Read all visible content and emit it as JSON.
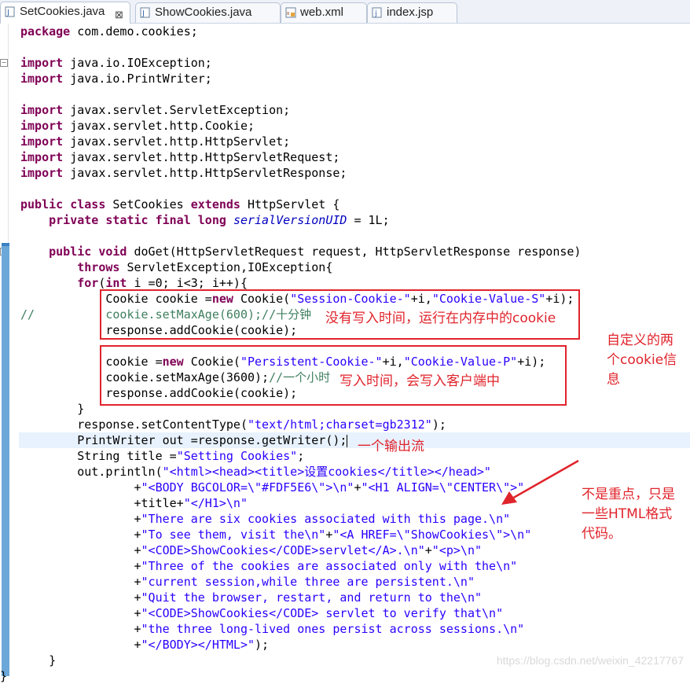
{
  "tabs": [
    {
      "label": "SetCookies.java",
      "icon": "java-file-icon",
      "active": true,
      "close": "⊠"
    },
    {
      "label": "ShowCookies.java",
      "icon": "java-file-icon"
    },
    {
      "label": "web.xml",
      "icon": "xml-file-icon"
    },
    {
      "label": "index.jsp",
      "icon": "jsp-file-icon"
    }
  ],
  "code": {
    "package": "com.demo.cookies;",
    "imports": [
      "java.io.IOException;",
      "java.io.PrintWriter;",
      "javax.servlet.ServletException;",
      "javax.servlet.http.Cookie;",
      "javax.servlet.http.HttpServlet;",
      "javax.servlet.http.HttpServletRequest;",
      "javax.servlet.http.HttpServletResponse;"
    ],
    "class_name": " SetCookies ",
    "super_name": " HttpServlet {",
    "field_name": "serialVersionUID",
    "field_value": " = 1L;",
    "method_sig": " doGet(HttpServletRequest request, HttpServletResponse response)",
    "throws_list": " ServletException,IOException{",
    "for_head": "(",
    "for_rest": " i =0; i<3; i++){",
    "c1_prefix": "Cookie cookie =",
    "c1_mid": " Cookie(",
    "c1_name": "\"Session-Cookie-\"",
    "c1_plus": "+i,",
    "c1_value": "\"Cookie-Value-S\"",
    "c1_end": "+i);",
    "commented_line": "//          cookie.setMaxAge(600);//十分钟",
    "add_cookie": "response.addCookie(cookie);",
    "c2_prefix": "cookie =",
    "c2_name": "\"Persistent-Cookie-\"",
    "c2_value": "\"Cookie-Value-P\"",
    "setmaxage": "cookie.setMaxAge(3600);",
    "setmaxage_cmt": "//一个小时",
    "close_brace": "}",
    "set_ct_a": "response.setContentType(",
    "set_ct_str": "\"text/html;charset=gb2312\"",
    "set_ct_b": ");",
    "writer_line": "PrintWriter out =response.getWriter();",
    "title_a": "String title =",
    "title_str": "\"Setting Cookies\"",
    "title_b": ";",
    "println_a": "out.println(",
    "println_str": "\"<html><head><title>设置cookies</title></head>\"",
    "html_lines": [
      {
        "a": "+",
        "s": "\"<BODY BGCOLOR=\\\"#FDF5E6\\\">\\n\"",
        "b": "+",
        "s2": "\"<H1 ALIGN=\\\"CENTER\\\">\""
      },
      {
        "a": "+title+",
        "s": "\"</H1>\\n\"",
        "b": "",
        "s2": ""
      },
      {
        "a": "+",
        "s": "\"There are six cookies associated with this page.\\n\"",
        "b": "",
        "s2": ""
      },
      {
        "a": "+",
        "s": "\"To see them, visit the\\n\"",
        "b": "+",
        "s2": "\"<A HREF=\\\"ShowCookies\\\">\\n\""
      },
      {
        "a": "+",
        "s": "\"<CODE>ShowCookies</CODE>servlet</A>.\\n\"",
        "b": "+",
        "s2": "\"<p>\\n\""
      },
      {
        "a": "+",
        "s": "\"Three of the cookies are associated only with the\\n\"",
        "b": "",
        "s2": ""
      },
      {
        "a": "+",
        "s": "\"current session,while three are persistent.\\n\"",
        "b": "",
        "s2": ""
      },
      {
        "a": "+",
        "s": "\"Quit the browser, restart, and return to the\\n\"",
        "b": "",
        "s2": ""
      },
      {
        "a": "+",
        "s": "\"<CODE>ShowCookies</CODE> servlet to verify that\\n\"",
        "b": "",
        "s2": ""
      },
      {
        "a": "+",
        "s": "\"the three long-lived ones persist across sessions.\\n\"",
        "b": "",
        "s2": ""
      },
      {
        "a": "+",
        "s": "\"</BODY></HTML>\"",
        "b": ");",
        "s2": ""
      }
    ],
    "method_close": "}",
    "class_close": "}",
    "keywords": {
      "package": "package",
      "import": "import",
      "public": "public",
      "class": "class",
      "extends": "extends",
      "private": "private",
      "static": "static",
      "final": "final",
      "long": "long",
      "void": "void",
      "throws": "throws",
      "for": "for",
      "int": "int",
      "new": "new"
    }
  },
  "annotations": {
    "box1_note": "没有写入时间，运行在内存中的cookie",
    "box2_note": "写入时间，会写入客户端中",
    "side_note": [
      "自定义的两",
      "个cookie信",
      "息"
    ],
    "stream_note": "一个输出流",
    "html_note": [
      "不是重点，只是",
      "一些HTML格式",
      "代码。"
    ]
  },
  "watermark": "https://blog.csdn.net/weixin_42217767",
  "colors": {
    "keyword": "#7f0055",
    "string": "#2a00ff",
    "field": "#0000c0",
    "comment": "#3f7f5f",
    "annotation": "#e0242c"
  }
}
